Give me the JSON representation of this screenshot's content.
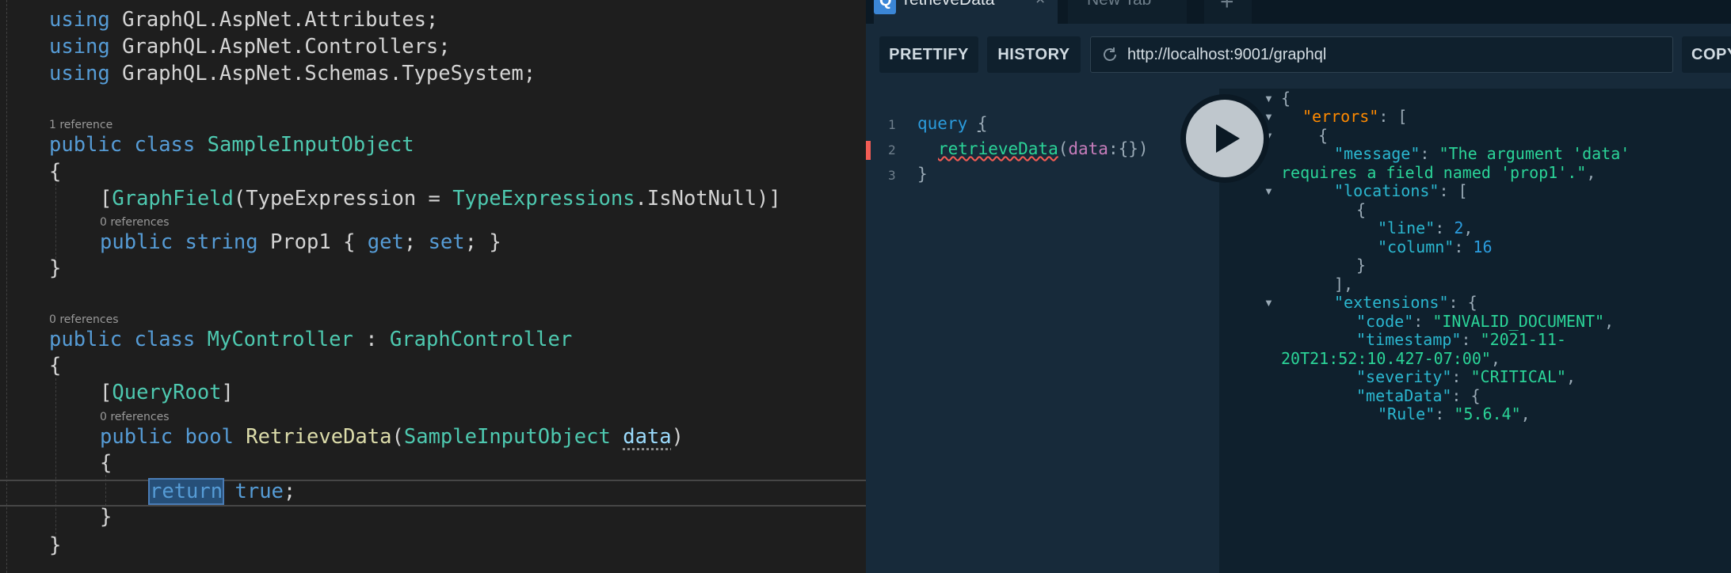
{
  "editor": {
    "lines": {
      "l1": {
        "kw": "using",
        "rest": " GraphQL.AspNet.Attributes;"
      },
      "l2": {
        "kw": "using",
        "rest": " GraphQL.AspNet.Controllers;"
      },
      "l3": {
        "kw": "using",
        "rest": " GraphQL.AspNet.Schemas.TypeSystem;"
      },
      "lens1": "1 reference",
      "l5": {
        "kw1": "public",
        "kw2": "class",
        "type": "SampleInputObject"
      },
      "brace_open": "{",
      "brace_close": "}",
      "l7": {
        "open": "[",
        "attr": "GraphField",
        "p1": "(TypeExpression = ",
        "type": "TypeExpressions",
        "p2": ".IsNotNull)]"
      },
      "lens2": "0 references",
      "l8": {
        "kw1": "public",
        "kw2": "string",
        "name": " Prop1 { ",
        "get": "get",
        "semi": "; ",
        "set": "set",
        "end": "; }"
      },
      "lens3": "0 references",
      "l11": {
        "kw1": "public",
        "kw2": "class",
        "type": "MyController",
        "colon": " : ",
        "base": "GraphController"
      },
      "l13": {
        "open": "[",
        "attr": "QueryRoot",
        "close": "]"
      },
      "lens4": "0 references",
      "l14": {
        "kw1": "public",
        "kw2": "bool",
        "fn": "RetrieveData",
        "open": "(",
        "type": "SampleInputObject",
        "param": "data",
        "close": ")"
      },
      "l16": {
        "kw1": "return",
        "kw2": "true",
        "semi": ";"
      }
    }
  },
  "graphiql": {
    "tabs": {
      "active": "retrieveData",
      "close": "×",
      "second": "New Tab",
      "add": "+"
    },
    "toolbar": {
      "prettify": "PRETTIFY",
      "history": "HISTORY",
      "url": "http://localhost:9001/graphql",
      "copy": "COPY"
    },
    "query": {
      "line_numbers": [
        "1",
        "2",
        "3"
      ],
      "line1": {
        "kw": "query",
        "brace": "{"
      },
      "line2": {
        "field": "retrieveData",
        "open": "(",
        "arg": "data",
        "rest": ":{})"
      },
      "line3": "}"
    },
    "result": {
      "open_brace": "{",
      "errors_key": "\"errors\"",
      "bracket_open": "[",
      "obj_open": "{",
      "message_key": "\"message\"",
      "message_part1": "\"The argument 'data'",
      "message_part2": "requires a field named 'prop1'.\"",
      "locations_key": "\"locations\"",
      "loc_obj_open": "{",
      "line_key": "\"line\"",
      "line_val": "2",
      "column_key": "\"column\"",
      "column_val": "16",
      "loc_obj_close": "}",
      "bracket_close": "],",
      "extensions_key": "\"extensions\"",
      "code_key": "\"code\"",
      "code_val": "\"INVALID_DOCUMENT\"",
      "timestamp_key": "\"timestamp\"",
      "timestamp_part1": "\"2021-11-",
      "timestamp_part2": "20T21:52:10.427-07:00\"",
      "severity_key": "\"severity\"",
      "severity_val": "\"CRITICAL\"",
      "metadata_key": "\"metaData\"",
      "rule_key": "\"Rule\"",
      "rule_val": "\"5.6.4\""
    }
  },
  "colors": {
    "editor_bg": "#1e1e1e",
    "keyword": "#569cd6",
    "type": "#4ec9b0",
    "method": "#dcdcaa",
    "graphiql_bg": "#172a3a",
    "json_string": "#2bd498",
    "json_key": "#2bb7d0"
  },
  "icons": [
    "query-q-icon",
    "close-icon",
    "plus-icon",
    "reload-icon",
    "play-icon",
    "collapse-arrow-icon"
  ]
}
